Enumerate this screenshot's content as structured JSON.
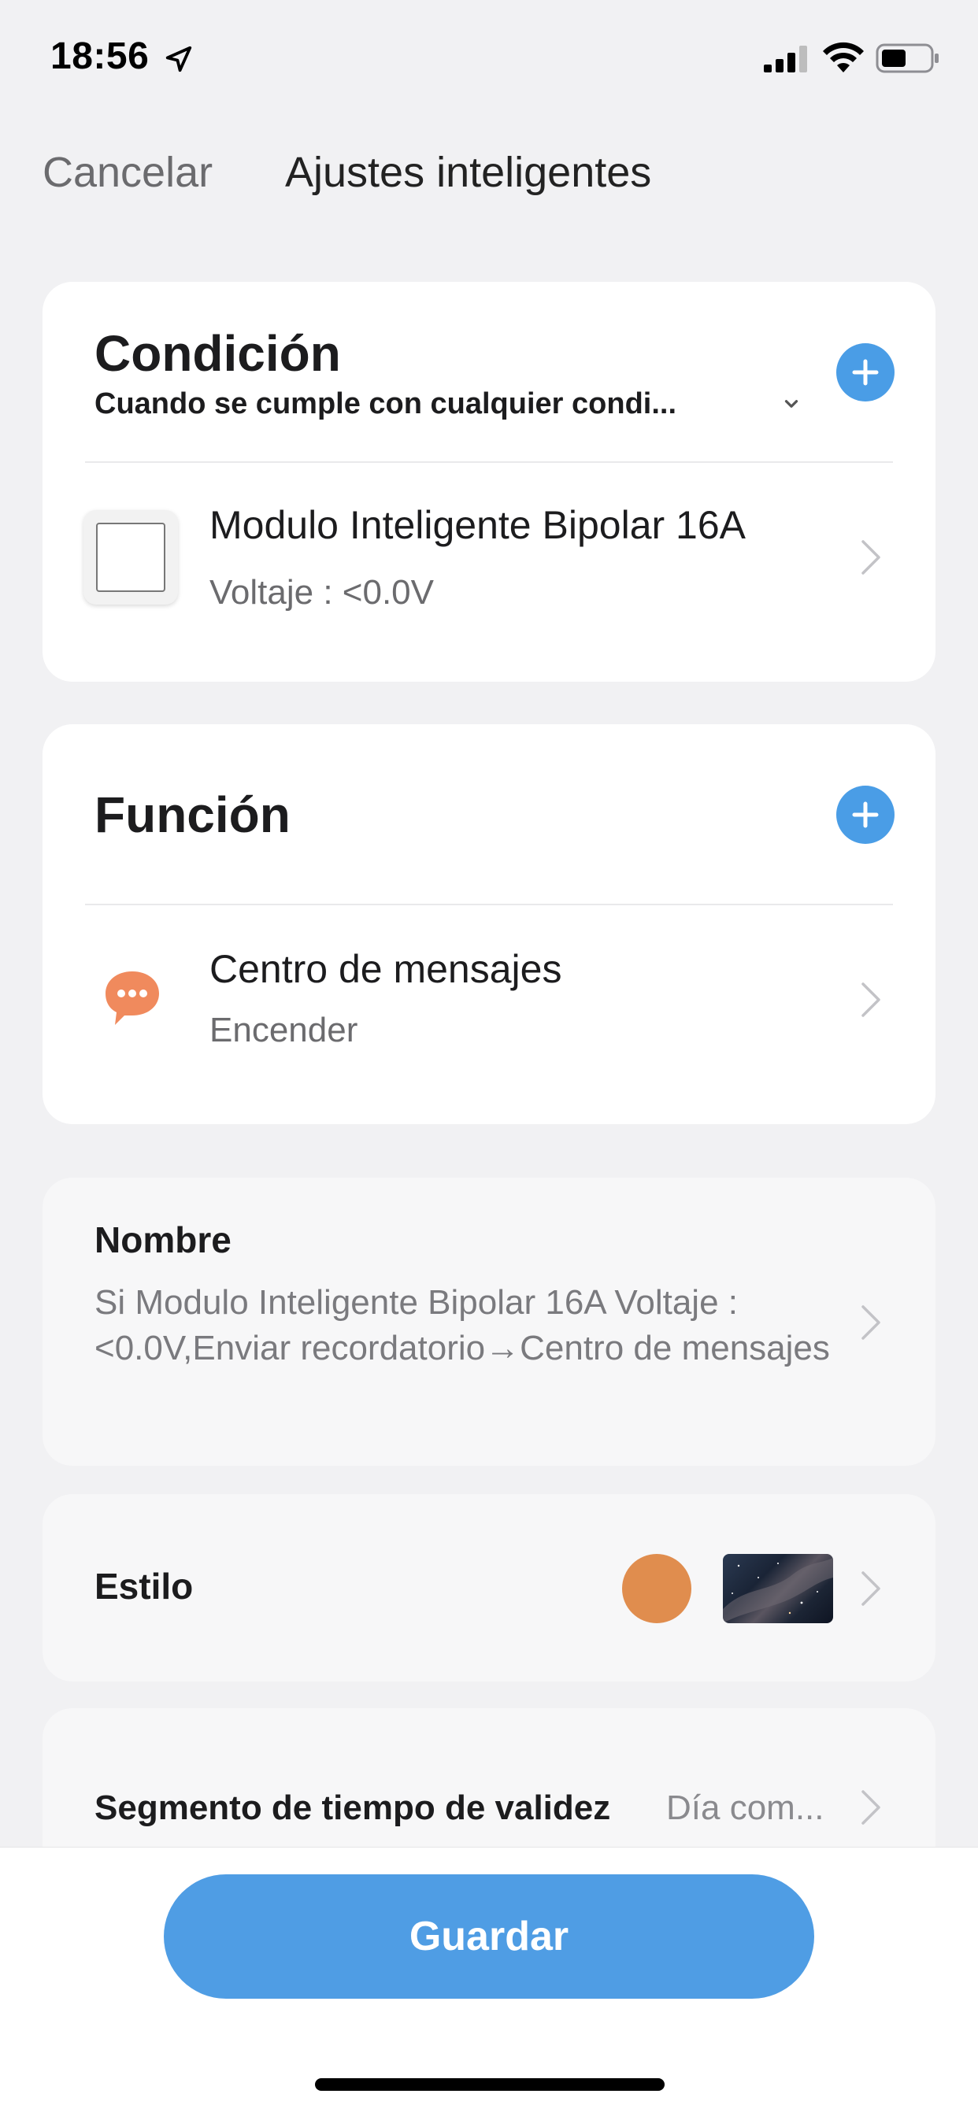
{
  "status_bar": {
    "time": "18:56"
  },
  "nav": {
    "cancel_label": "Cancelar",
    "title": "Ajustes inteligentes"
  },
  "condition": {
    "title": "Condición",
    "subtitle": "Cuando se cumple con cualquier condi...",
    "item": {
      "title": "Modulo Inteligente Bipolar 16A",
      "subtitle": "Voltaje : <0.0V"
    }
  },
  "function": {
    "title": "Función",
    "item": {
      "title": "Centro de mensajes",
      "subtitle": "Encender"
    }
  },
  "name": {
    "label": "Nombre",
    "value": "Si Modulo Inteligente Bipolar 16A Voltaje : <0.0V,Enviar recordatorio→Centro de mensajes"
  },
  "style": {
    "label": "Estilo",
    "color": "#e08d4e"
  },
  "validity": {
    "label": "Segmento de tiempo de validez",
    "value": "Día com..."
  },
  "footer": {
    "save_label": "Guardar"
  },
  "colors": {
    "accent": "#4f9de4",
    "background": "#f1f1f3",
    "message_icon": "#f08a5d"
  }
}
